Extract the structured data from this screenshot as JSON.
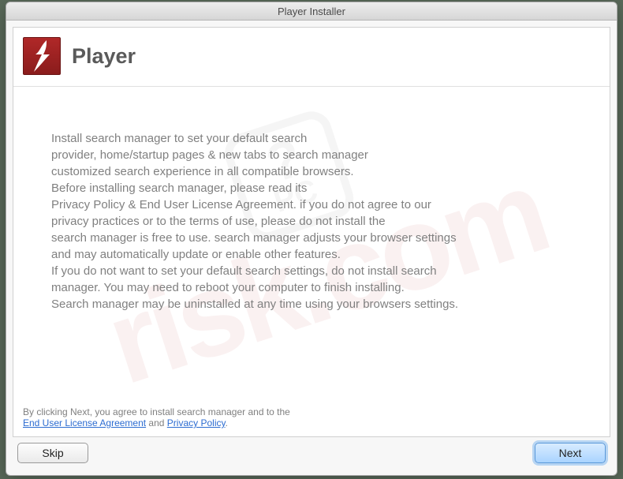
{
  "window": {
    "title": "Player Installer"
  },
  "header": {
    "app_name": "Player"
  },
  "body": {
    "text": "Install search manager to set your default search\nprovider, home/startup pages & new tabs to search manager\ncustomized search experience in all compatible browsers.\nBefore installing search manager, please read its\nPrivacy Policy & End User License Agreement. if you do not agree to our\nprivacy practices or to the terms of use, please do not install the\nsearch manager is free to use. search manager adjusts your browser settings\nand may automatically update or enable other features.\nIf you do not want to set your default search settings, do not install search\nmanager. You may need to reboot your computer to finish installing.\nSearch manager may be uninstalled at any time using your browsers settings."
  },
  "footer": {
    "prefix": "By clicking Next, you agree to install search manager and to the",
    "eula": "End User License Agreement",
    "and": " and ",
    "privacy": "Privacy Policy",
    "suffix": "."
  },
  "buttons": {
    "skip": "Skip",
    "next": "Next"
  },
  "watermark": {
    "site": "risk.com"
  }
}
